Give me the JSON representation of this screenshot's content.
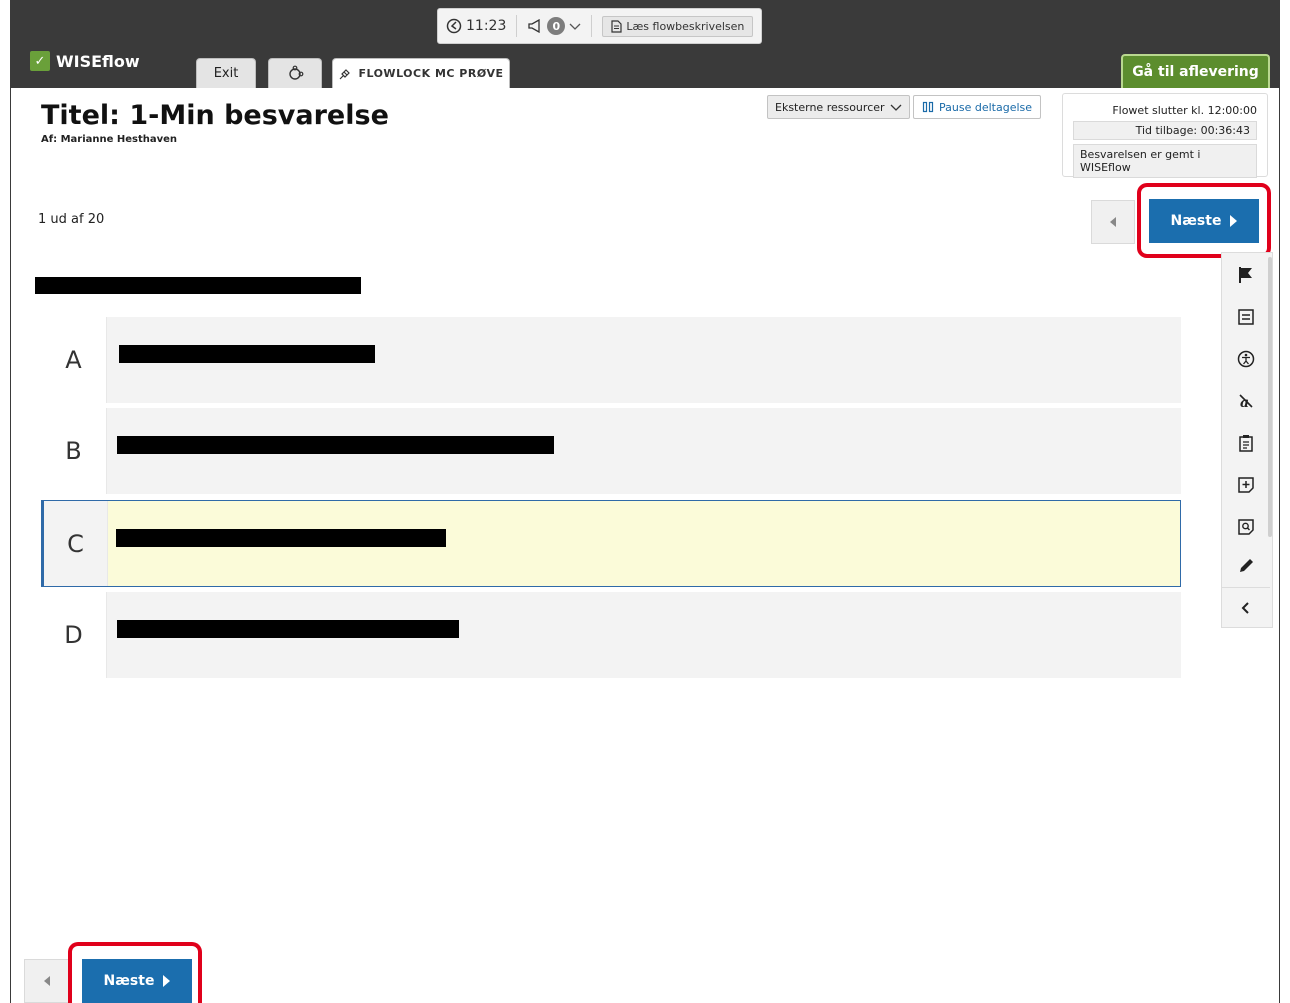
{
  "status": {
    "time": "11:23",
    "notifications": "0",
    "flow_description": "Læs flowbeskrivelsen"
  },
  "brand": {
    "name": "WISEflow",
    "accent": "#6aa03a"
  },
  "tabs": {
    "exit": "Exit",
    "active": "FLOWLOCK MC PRØVE"
  },
  "submit": "Gå til aflevering",
  "header": {
    "title": "Titel: 1-Min besvarelse",
    "author": "Af: Marianne Hesthaven"
  },
  "toolbar": {
    "external": "Eksterne ressourcer",
    "pause": "Pause deltagelse"
  },
  "info": {
    "flow_ends": "Flowet slutter kl. 12:00:00",
    "time_left": "Tid tilbage: 00:36:43",
    "saved": "Besvarelsen er gemt i WISEflow"
  },
  "progress": {
    "counter": "1 ud af 20"
  },
  "navigation": {
    "next": "Næste"
  },
  "options": [
    {
      "letter": "A",
      "selected": false
    },
    {
      "letter": "B",
      "selected": false
    },
    {
      "letter": "C",
      "selected": true
    },
    {
      "letter": "D",
      "selected": false
    }
  ],
  "colors": {
    "primary": "#1b6eae",
    "submit": "#5c8d2e",
    "highlight": "#e0001b",
    "selected_bg": "#fbfbd9"
  }
}
